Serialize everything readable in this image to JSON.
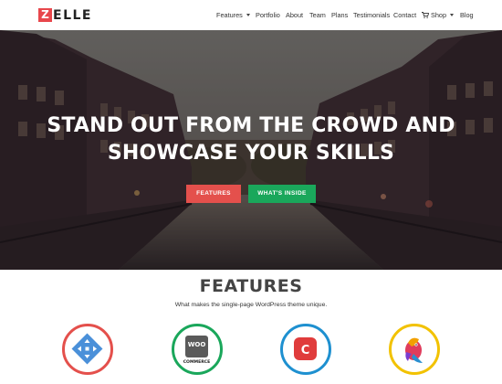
{
  "header": {
    "logo_initial": "Z",
    "logo_rest": "ELLE",
    "nav": [
      {
        "label": "Features",
        "dropdown": true
      },
      {
        "label": "Portfolio"
      },
      {
        "label": "About"
      },
      {
        "label": "Team"
      },
      {
        "label": "Plans"
      },
      {
        "label": "Testimonials"
      },
      {
        "label": "Contact"
      },
      {
        "label": "Shop",
        "dropdown": true,
        "icon": "cart-icon"
      },
      {
        "label": "Blog"
      }
    ]
  },
  "hero": {
    "title_line1": "STAND OUT FROM THE CROWD AND",
    "title_line2": "SHOWCASE YOUR SKILLS",
    "primary_button": "FEATURES",
    "secondary_button": "WHAT'S INSIDE"
  },
  "features": {
    "title": "FEATURES",
    "subtitle": "What makes the single-page WordPress theme unique.",
    "icons": [
      {
        "name": "navigation-arrows-icon",
        "color": "#e4504c"
      },
      {
        "name": "woocommerce-icon",
        "color": "#1aa75b",
        "text_top": "WOO",
        "text_bottom": "COMMERCE"
      },
      {
        "name": "c-logo-icon",
        "color": "#1e90d0",
        "letter": "C"
      },
      {
        "name": "parrot-icon",
        "color": "#f2c200"
      }
    ]
  },
  "colors": {
    "brand_red": "#e4504c",
    "brand_green": "#1aa75b"
  }
}
